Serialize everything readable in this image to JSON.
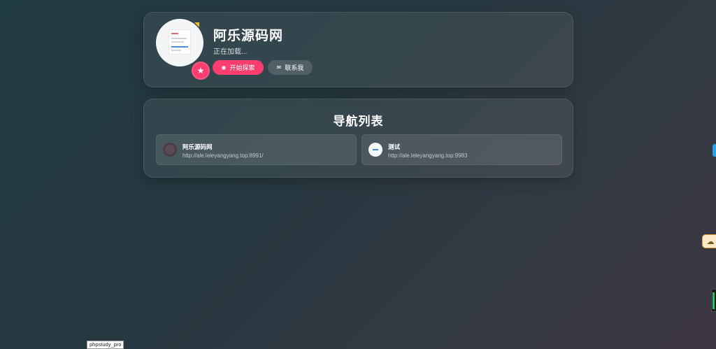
{
  "profile": {
    "name": "阿乐源码网",
    "subtitle": "正在加载...",
    "explore_label": "开始探索",
    "contact_label": "联系我",
    "explore_icon": "compass-icon",
    "contact_icon": "envelope-icon",
    "badge_icon": "star-icon",
    "accent": "#ff3d6e"
  },
  "nav": {
    "title": "导航列表",
    "items": [
      {
        "name": "阿乐源码网",
        "url": "http://ale.leleyangyang.top:8991/"
      },
      {
        "name": "测试",
        "url": "http://ale.leleyangyang.top:9983"
      }
    ]
  },
  "side_widgets": {
    "cloud_icon": "cloud-download-icon"
  },
  "status_tip": "phpstudy_pro"
}
